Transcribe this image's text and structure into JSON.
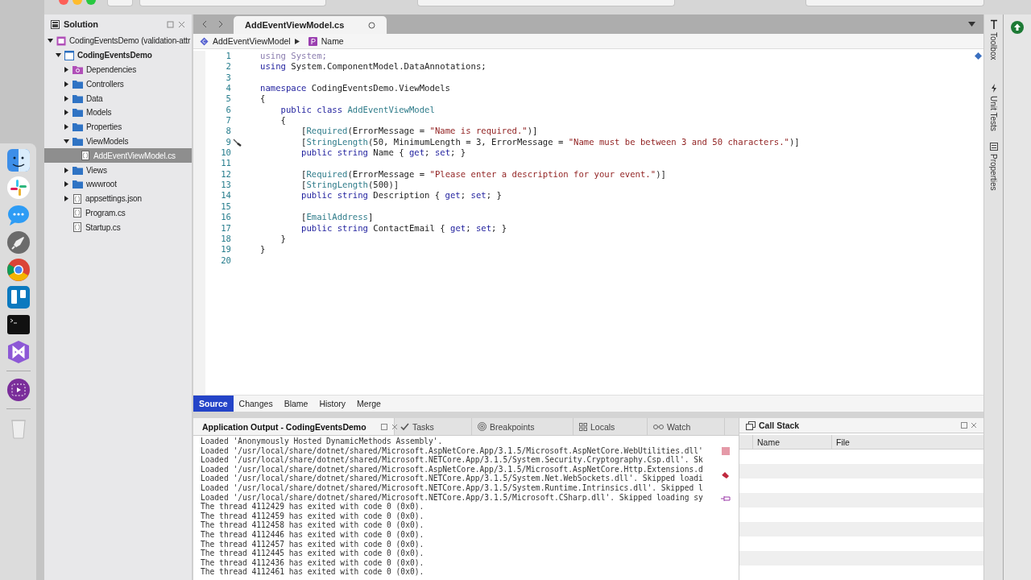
{
  "solution_pad": {
    "title": "Solution",
    "tree": [
      {
        "label": "CodingEventsDemo (validation-attr",
        "kind": "solution",
        "expanded": true,
        "selected": false,
        "children": [
          {
            "label": "CodingEventsDemo",
            "kind": "project",
            "expanded": true,
            "selected": false,
            "children": [
              {
                "label": "Dependencies",
                "kind": "deps",
                "expanded": false,
                "selected": false
              },
              {
                "label": "Controllers",
                "kind": "folder",
                "expanded": false,
                "selected": false
              },
              {
                "label": "Data",
                "kind": "folder",
                "expanded": false,
                "selected": false
              },
              {
                "label": "Models",
                "kind": "folder",
                "expanded": false,
                "selected": false
              },
              {
                "label": "Properties",
                "kind": "folder",
                "expanded": false,
                "selected": false
              },
              {
                "label": "ViewModels",
                "kind": "folder",
                "expanded": true,
                "selected": false,
                "children": [
                  {
                    "label": "AddEventViewModel.cs",
                    "kind": "file",
                    "selected": true
                  }
                ]
              },
              {
                "label": "Views",
                "kind": "folder",
                "expanded": false,
                "selected": false
              },
              {
                "label": "wwwroot",
                "kind": "folder",
                "expanded": false,
                "selected": false
              },
              {
                "label": "appsettings.json",
                "kind": "file",
                "expanded": false,
                "selected": false
              },
              {
                "label": "Program.cs",
                "kind": "file",
                "selected": false
              },
              {
                "label": "Startup.cs",
                "kind": "file",
                "selected": false
              }
            ]
          }
        ]
      }
    ]
  },
  "editor": {
    "tab": "AddEventViewModel.cs",
    "breadcrumb": [
      {
        "label": "AddEventViewModel",
        "kind": "class"
      },
      {
        "label": "Name",
        "kind": "property"
      }
    ],
    "lines": [
      {
        "number": "1",
        "tokens": [
          {
            "text": "using System;",
            "kind": "dim"
          }
        ]
      },
      {
        "number": "2",
        "tokens": [
          {
            "text": "using",
            "kind": "kw"
          },
          {
            "text": " System.ComponentModel.DataAnnotations;",
            "kind": "text"
          }
        ]
      },
      {
        "number": "3"
      },
      {
        "number": "4",
        "tokens": [
          {
            "text": "namespace",
            "kind": "kw"
          },
          {
            "text": " CodingEventsDemo.ViewModels",
            "kind": "text"
          }
        ]
      },
      {
        "number": "5",
        "tokens": [
          {
            "text": "{",
            "kind": "text"
          }
        ]
      },
      {
        "number": "6",
        "tokens": [
          {
            "text": "    public class",
            "kind": "kw"
          },
          {
            "text": " AddEventViewModel",
            "kind": "type"
          }
        ]
      },
      {
        "number": "7",
        "tokens": [
          {
            "text": "    {",
            "kind": "text"
          }
        ]
      },
      {
        "number": "8",
        "tokens": [
          {
            "text": "        [",
            "kind": "text"
          },
          {
            "text": "Required",
            "kind": "type"
          },
          {
            "text": "(ErrorMessage = ",
            "kind": "text"
          },
          {
            "text": "\"Name is required.\"",
            "kind": "str"
          },
          {
            "text": ")]",
            "kind": "text"
          }
        ]
      },
      {
        "number": "9",
        "fix": true,
        "tokens": [
          {
            "text": "        [",
            "kind": "text"
          },
          {
            "text": "StringLength",
            "kind": "type"
          },
          {
            "text": "(50, MinimumLength = 3, ErrorMessage = ",
            "kind": "text"
          },
          {
            "text": "\"Name must be between 3 and 50 characters.\"",
            "kind": "str"
          },
          {
            "text": ")]",
            "kind": "text"
          }
        ]
      },
      {
        "number": "10",
        "tokens": [
          {
            "text": "        public string",
            "kind": "kw"
          },
          {
            "text": " Name { ",
            "kind": "text"
          },
          {
            "text": "get",
            "kind": "kw"
          },
          {
            "text": "; ",
            "kind": "text"
          },
          {
            "text": "set",
            "kind": "kw"
          },
          {
            "text": "; }",
            "kind": "text"
          }
        ]
      },
      {
        "number": "11"
      },
      {
        "number": "12",
        "tokens": [
          {
            "text": "        [",
            "kind": "text"
          },
          {
            "text": "Required",
            "kind": "type"
          },
          {
            "text": "(ErrorMessage = ",
            "kind": "text"
          },
          {
            "text": "\"Please enter a description for your event.\"",
            "kind": "str"
          },
          {
            "text": ")]",
            "kind": "text"
          }
        ]
      },
      {
        "number": "13",
        "tokens": [
          {
            "text": "        [",
            "kind": "text"
          },
          {
            "text": "StringLength",
            "kind": "type"
          },
          {
            "text": "(500)]",
            "kind": "text"
          }
        ]
      },
      {
        "number": "14",
        "tokens": [
          {
            "text": "        public string",
            "kind": "kw"
          },
          {
            "text": " Description { ",
            "kind": "text"
          },
          {
            "text": "get",
            "kind": "kw"
          },
          {
            "text": "; ",
            "kind": "text"
          },
          {
            "text": "set",
            "kind": "kw"
          },
          {
            "text": "; }",
            "kind": "text"
          }
        ]
      },
      {
        "number": "15"
      },
      {
        "number": "16",
        "tokens": [
          {
            "text": "        [",
            "kind": "text"
          },
          {
            "text": "EmailAddress",
            "kind": "type"
          },
          {
            "text": "]",
            "kind": "text"
          }
        ]
      },
      {
        "number": "17",
        "tokens": [
          {
            "text": "        public string",
            "kind": "kw"
          },
          {
            "text": " ContactEmail { ",
            "kind": "text"
          },
          {
            "text": "get",
            "kind": "kw"
          },
          {
            "text": "; ",
            "kind": "text"
          },
          {
            "text": "set",
            "kind": "kw"
          },
          {
            "text": "; }",
            "kind": "text"
          }
        ]
      },
      {
        "number": "18",
        "tokens": [
          {
            "text": "    }",
            "kind": "text"
          }
        ]
      },
      {
        "number": "19",
        "tokens": [
          {
            "text": "}",
            "kind": "text"
          }
        ]
      },
      {
        "number": "20"
      }
    ]
  },
  "view_tabs": [
    {
      "label": "Source",
      "selected": true
    },
    {
      "label": "Changes",
      "selected": false
    },
    {
      "label": "Blame",
      "selected": false
    },
    {
      "label": "History",
      "selected": false
    },
    {
      "label": "Merge",
      "selected": false
    }
  ],
  "output_pad": {
    "tabs": [
      {
        "label": "Application Output - CodingEventsDemo",
        "kind": "output",
        "selected": true
      },
      {
        "label": "Tasks",
        "kind": "tasks",
        "selected": false
      },
      {
        "label": "Breakpoints",
        "kind": "breakpoints",
        "selected": false
      },
      {
        "label": "Locals",
        "kind": "locals",
        "selected": false
      },
      {
        "label": "Watch",
        "kind": "watch",
        "selected": false
      }
    ],
    "lines": [
      "Loaded 'Anonymously Hosted DynamicMethods Assembly'.",
      "Loaded '/usr/local/share/dotnet/shared/Microsoft.AspNetCore.App/3.1.5/Microsoft.AspNetCore.WebUtilities.dll'",
      "Loaded '/usr/local/share/dotnet/shared/Microsoft.NETCore.App/3.1.5/System.Security.Cryptography.Csp.dll'. Sk",
      "Loaded '/usr/local/share/dotnet/shared/Microsoft.AspNetCore.App/3.1.5/Microsoft.AspNetCore.Http.Extensions.d",
      "Loaded '/usr/local/share/dotnet/shared/Microsoft.NETCore.App/3.1.5/System.Net.WebSockets.dll'. Skipped loadi",
      "Loaded '/usr/local/share/dotnet/shared/Microsoft.NETCore.App/3.1.5/System.Runtime.Intrinsics.dll'. Skipped l",
      "Loaded '/usr/local/share/dotnet/shared/Microsoft.NETCore.App/3.1.5/Microsoft.CSharp.dll'. Skipped loading sy",
      "The thread 4112429 has exited with code 0 (0x0).",
      "The thread 4112459 has exited with code 0 (0x0).",
      "The thread 4112458 has exited with code 0 (0x0).",
      "The thread 4112446 has exited with code 0 (0x0).",
      "The thread 4112457 has exited with code 0 (0x0).",
      "The thread 4112445 has exited with code 0 (0x0).",
      "The thread 4112436 has exited with code 0 (0x0).",
      "The thread 4112461 has exited with code 0 (0x0)."
    ]
  },
  "call_stack": {
    "title": "Call Stack",
    "columns": [
      "Name",
      "File"
    ]
  },
  "side_tabs": [
    {
      "label": "Toolbox",
      "kind": "toolbox"
    },
    {
      "label": "Unit Tests",
      "kind": "tests"
    },
    {
      "label": "Properties",
      "kind": "properties"
    }
  ]
}
